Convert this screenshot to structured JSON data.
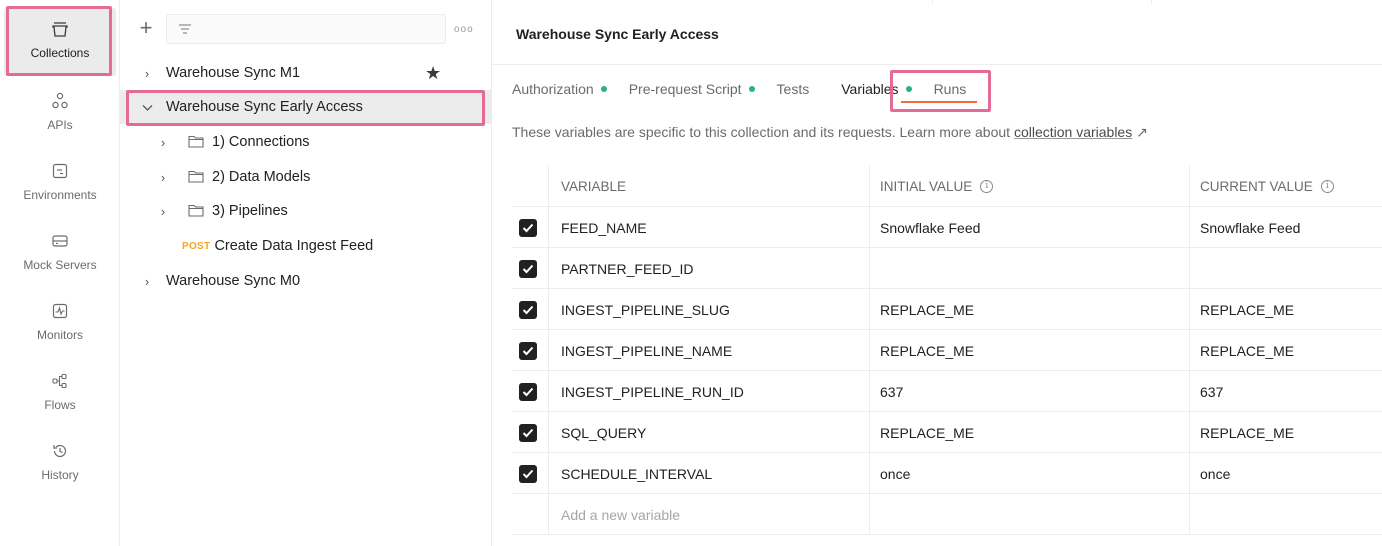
{
  "rail": {
    "items": [
      {
        "label": "Collections",
        "icon": "collections-icon",
        "active": true
      },
      {
        "label": "APIs",
        "icon": "apis-icon"
      },
      {
        "label": "Environments",
        "icon": "environments-icon"
      },
      {
        "label": "Mock Servers",
        "icon": "mock-servers-icon"
      },
      {
        "label": "Monitors",
        "icon": "monitors-icon"
      },
      {
        "label": "Flows",
        "icon": "flows-icon"
      },
      {
        "label": "History",
        "icon": "history-icon"
      }
    ]
  },
  "sidebar": {
    "more_label": "ooo",
    "tree": [
      {
        "label": "Warehouse Sync M1",
        "type": "collection",
        "expanded": false,
        "starred": true
      },
      {
        "label": "Warehouse Sync Early Access",
        "type": "collection",
        "expanded": true,
        "selected": true
      },
      {
        "label": "1) Connections",
        "type": "folder"
      },
      {
        "label": "2) Data Models",
        "type": "folder"
      },
      {
        "label": "3) Pipelines",
        "type": "folder"
      },
      {
        "label": "Create Data Ingest Feed",
        "type": "request",
        "method": "POST"
      },
      {
        "label": "Warehouse Sync M0",
        "type": "collection",
        "expanded": false
      }
    ]
  },
  "main": {
    "title": "Warehouse Sync Early Access",
    "tabs": [
      {
        "label": "Authorization",
        "dot": true
      },
      {
        "label": "Pre-request Script",
        "dot": true
      },
      {
        "label": "Tests",
        "dot": false
      },
      {
        "label": "Variables",
        "dot": true,
        "active": true
      },
      {
        "label": "Runs",
        "dot": false
      }
    ],
    "info_text": "These variables are specific to this collection and its requests. Learn more about",
    "info_link": "collection variables",
    "info_arrow": "↗"
  },
  "table": {
    "headers": {
      "variable": "VARIABLE",
      "initial": "INITIAL VALUE",
      "current": "CURRENT VALUE"
    },
    "rows": [
      {
        "name": "FEED_NAME",
        "initial": "Snowflake Feed",
        "current": "Snowflake Feed",
        "checked": true
      },
      {
        "name": "PARTNER_FEED_ID",
        "initial": "",
        "current": "",
        "checked": true
      },
      {
        "name": "INGEST_PIPELINE_SLUG",
        "initial": "REPLACE_ME",
        "current": "REPLACE_ME",
        "checked": true
      },
      {
        "name": "INGEST_PIPELINE_NAME",
        "initial": "REPLACE_ME",
        "current": "REPLACE_ME",
        "checked": true
      },
      {
        "name": "INGEST_PIPELINE_RUN_ID",
        "initial": "637",
        "current": "637",
        "checked": true
      },
      {
        "name": "SQL_QUERY",
        "initial": "REPLACE_ME",
        "current": "REPLACE_ME",
        "checked": true
      },
      {
        "name": "SCHEDULE_INTERVAL",
        "initial": "once",
        "current": "once",
        "checked": true
      }
    ],
    "add_placeholder": "Add a new variable"
  },
  "colors": {
    "highlight": "#e46a97",
    "accent_underline": "#f26b3a",
    "status_dot": "#26b47f",
    "post": "#f5a623"
  }
}
